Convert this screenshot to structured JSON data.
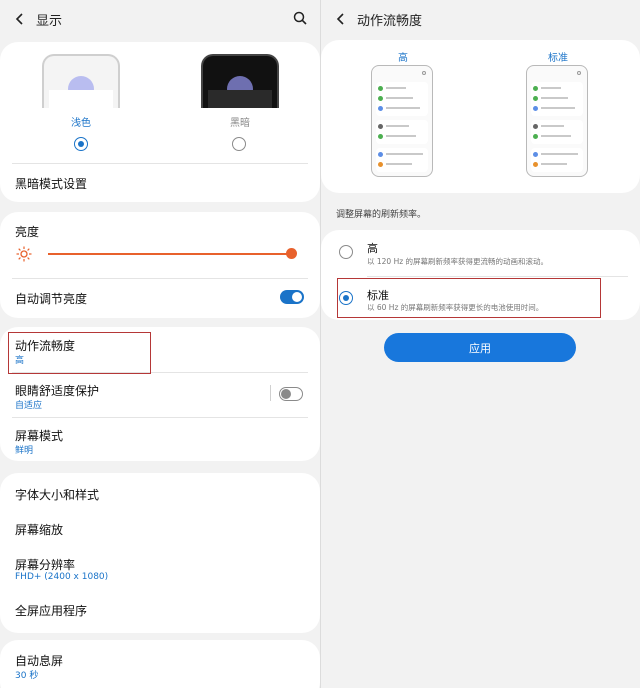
{
  "left": {
    "header": {
      "title": "显示"
    },
    "theme": {
      "light_label": "浅色",
      "dark_label": "黑暗"
    },
    "dark_settings": "黑暗模式设置",
    "brightness": {
      "label": "亮度",
      "level": 1.0
    },
    "auto_brightness": {
      "label": "自动调节亮度",
      "on": true
    },
    "motion": {
      "label": "动作流畅度",
      "value": "高"
    },
    "eye_comfort": {
      "label": "眼睛舒适度保护",
      "value": "自适应",
      "on": false
    },
    "screen_mode": {
      "label": "屏幕模式",
      "value": "鲜明"
    },
    "font": {
      "label": "字体大小和样式"
    },
    "zoom": {
      "label": "屏幕缩放"
    },
    "resolution": {
      "label": "屏幕分辨率",
      "value": "FHD+ (2400 x 1080)"
    },
    "fullscreen": {
      "label": "全屏应用程序"
    },
    "timeout": {
      "label": "自动息屏",
      "value": "30 秒"
    }
  },
  "right": {
    "header": {
      "title": "动作流畅度"
    },
    "preview": {
      "high_label": "高",
      "standard_label": "标准"
    },
    "mock_items": [
      "Digital Wellbeing and parental controls",
      "Battery and device care",
      "Apps",
      "General management",
      "Accessibility",
      "Software update",
      "Tips and user manual"
    ],
    "hint": "调整屏幕的刷新频率。",
    "options": [
      {
        "title": "高",
        "desc": "以 120 Hz 的屏幕刷新频率获得更流畅的动画和滚动。",
        "selected": false
      },
      {
        "title": "标准",
        "desc": "以 60 Hz 的屏幕刷新频率获得更长的电池使用时间。",
        "selected": true
      }
    ],
    "apply_label": "应用"
  },
  "colors": {
    "accent": "#1a73c8",
    "brightness_orange": "#e8612c",
    "highlight_red": "#b53737",
    "apply_blue": "#1877dc"
  }
}
